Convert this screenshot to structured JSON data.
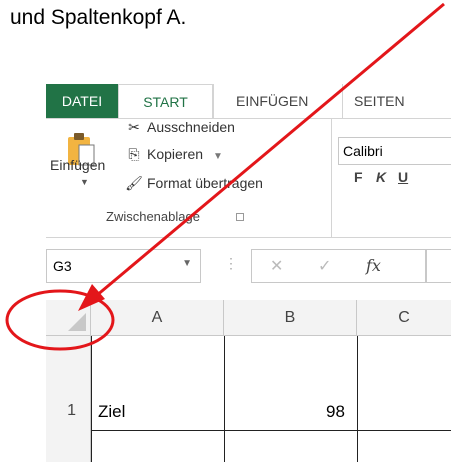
{
  "caption": "und Spaltenkopf A.",
  "ribbon": {
    "tabs": {
      "file": "DATEI",
      "start": "START",
      "insert": "EINFÜGEN",
      "pages": "SEITEN"
    },
    "clipboard": {
      "paste": "Einfügen",
      "cut": "Ausschneiden",
      "copy": "Kopieren",
      "format_painter": "Format übertragen",
      "group_label": "Zwischenablage"
    },
    "font": {
      "name": "Calibri",
      "bold": "F",
      "italic": "K",
      "underline": "U"
    }
  },
  "formula_bar": {
    "name_box": "G3",
    "fx": "fx"
  },
  "grid": {
    "columns": [
      "A",
      "B",
      "C"
    ],
    "rows": [
      {
        "number": "1",
        "A": "Ziel",
        "B": "98"
      }
    ]
  },
  "colors": {
    "excel_green": "#217346",
    "annotation_red": "#e3161a"
  },
  "icons": [
    "clipboard-icon",
    "scissors-icon",
    "copy-icon",
    "paintbrush-icon",
    "select-all-triangle-icon"
  ]
}
